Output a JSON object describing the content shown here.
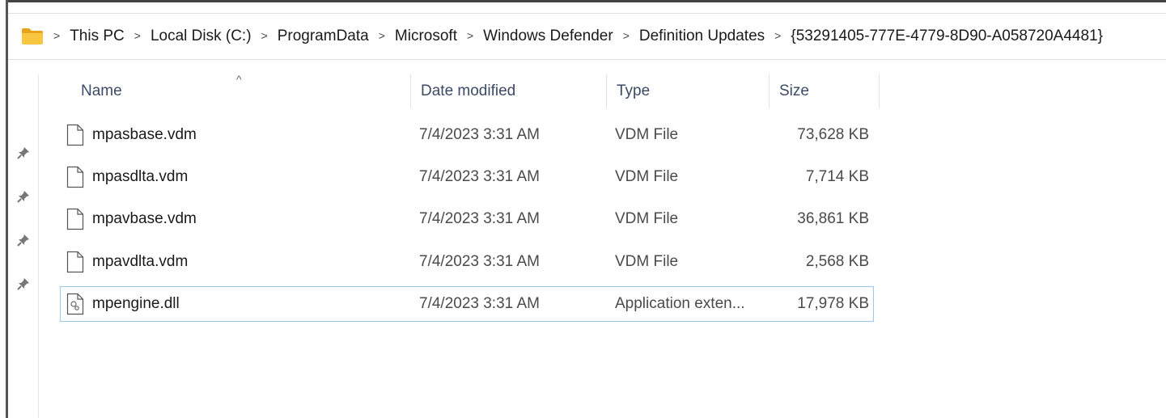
{
  "address_bar": {
    "crumbs": [
      "This PC",
      "Local Disk (C:)",
      "ProgramData",
      "Microsoft",
      "Windows Defender",
      "Definition Updates",
      "{53291405-777E-4779-8D90-A058720A4481}"
    ],
    "separator": ">"
  },
  "nav_pane": {
    "pins": [
      "pin-icon",
      "pin-icon",
      "pin-icon",
      "pin-icon"
    ]
  },
  "columns": {
    "name": "Name",
    "date": "Date modified",
    "type": "Type",
    "size": "Size",
    "sort_indicator": "^"
  },
  "files": [
    {
      "name": "mpasbase.vdm",
      "date": "7/4/2023 3:31 AM",
      "type": "VDM File",
      "size": "73,628 KB",
      "icon": "document-icon"
    },
    {
      "name": "mpasdlta.vdm",
      "date": "7/4/2023 3:31 AM",
      "type": "VDM File",
      "size": "7,714 KB",
      "icon": "document-icon"
    },
    {
      "name": "mpavbase.vdm",
      "date": "7/4/2023 3:31 AM",
      "type": "VDM File",
      "size": "36,861 KB",
      "icon": "document-icon"
    },
    {
      "name": "mpavdlta.vdm",
      "date": "7/4/2023 3:31 AM",
      "type": "VDM File",
      "size": "2,568 KB",
      "icon": "document-icon"
    },
    {
      "name": "mpengine.dll",
      "date": "7/4/2023 3:31 AM",
      "type": "Application exten...",
      "size": "17,978 KB",
      "icon": "dll-file-icon"
    }
  ],
  "colors": {
    "folder": "#f4c542",
    "selection_border": "#9cc8ee",
    "header_text": "#3b4a66"
  }
}
